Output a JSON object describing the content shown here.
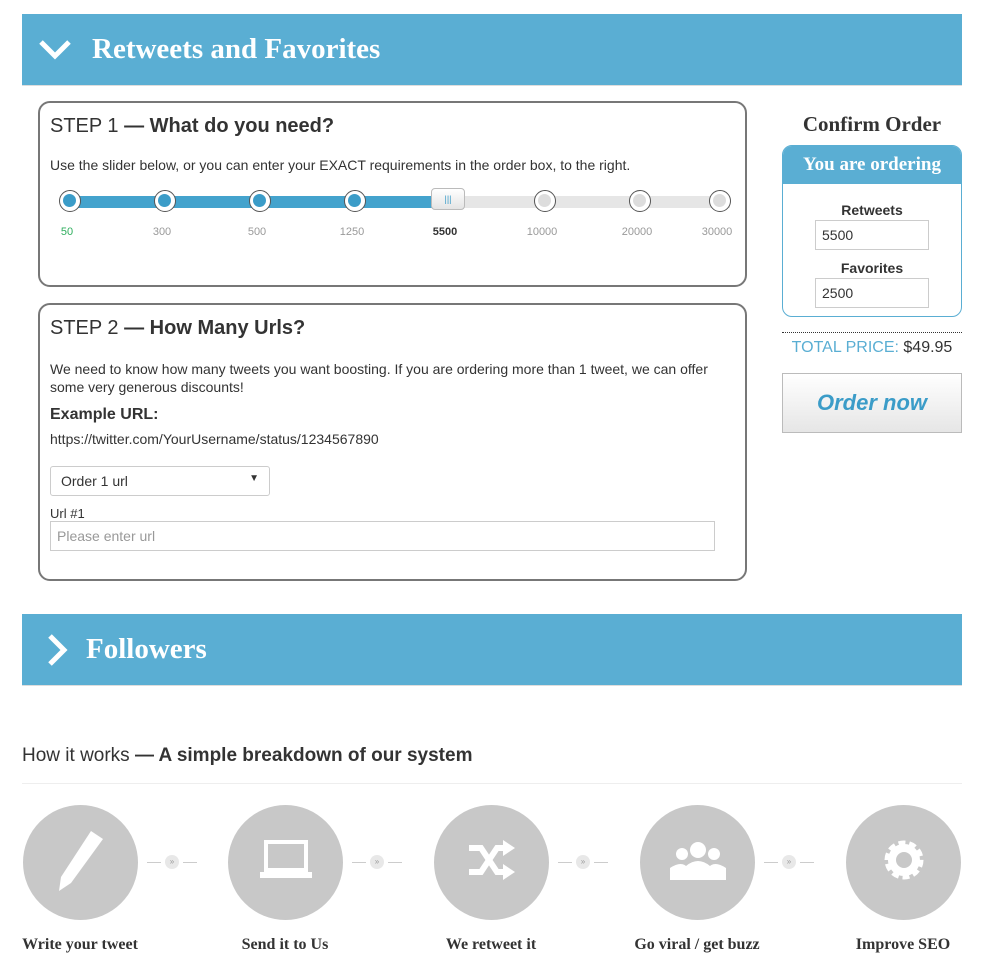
{
  "sections": {
    "retweets_title": "Retweets and Favorites",
    "followers_title": "Followers"
  },
  "step1": {
    "prefix": "STEP 1",
    "title": "— What do you need?",
    "desc": "Use the slider below, or you can enter your EXACT requirements in the order box, to the right.",
    "slider": {
      "ticks": [
        "50",
        "300",
        "500",
        "1250",
        "5500",
        "10000",
        "20000",
        "30000"
      ],
      "selected": "5500",
      "selected_index": 4
    }
  },
  "step2": {
    "prefix": "STEP 2",
    "title": "— How Many Urls?",
    "desc": "We need to know how many tweets you want boosting. If you are ordering more than 1 tweet, we can offer some very generous discounts!",
    "example_label": "Example URL:",
    "example_url": "https://twitter.com/YourUsername/status/1234567890",
    "select_value": "Order 1 url",
    "url_label": "Url #1",
    "url_placeholder": "Please enter url"
  },
  "order": {
    "title": "Confirm Order",
    "header": "You are ordering",
    "retweets_label": "Retweets",
    "retweets_value": "5500",
    "favorites_label": "Favorites",
    "favorites_value": "2500",
    "total_label": "TOTAL PRICE:",
    "total_value": "$49.95",
    "button": "Order now"
  },
  "how": {
    "title": "How it works",
    "subtitle": "— A simple breakdown of our system",
    "steps": [
      {
        "label": "Write your tweet",
        "icon": "pencil-icon"
      },
      {
        "label": "Send it to Us",
        "icon": "laptop-icon"
      },
      {
        "label": "We retweet it",
        "icon": "shuffle-icon"
      },
      {
        "label": "Go viral / get buzz",
        "icon": "users-icon"
      },
      {
        "label": "Improve SEO",
        "icon": "gear-icon"
      }
    ]
  },
  "colors": {
    "accent": "#5aaed3",
    "slider_fill": "#44a3cd"
  }
}
